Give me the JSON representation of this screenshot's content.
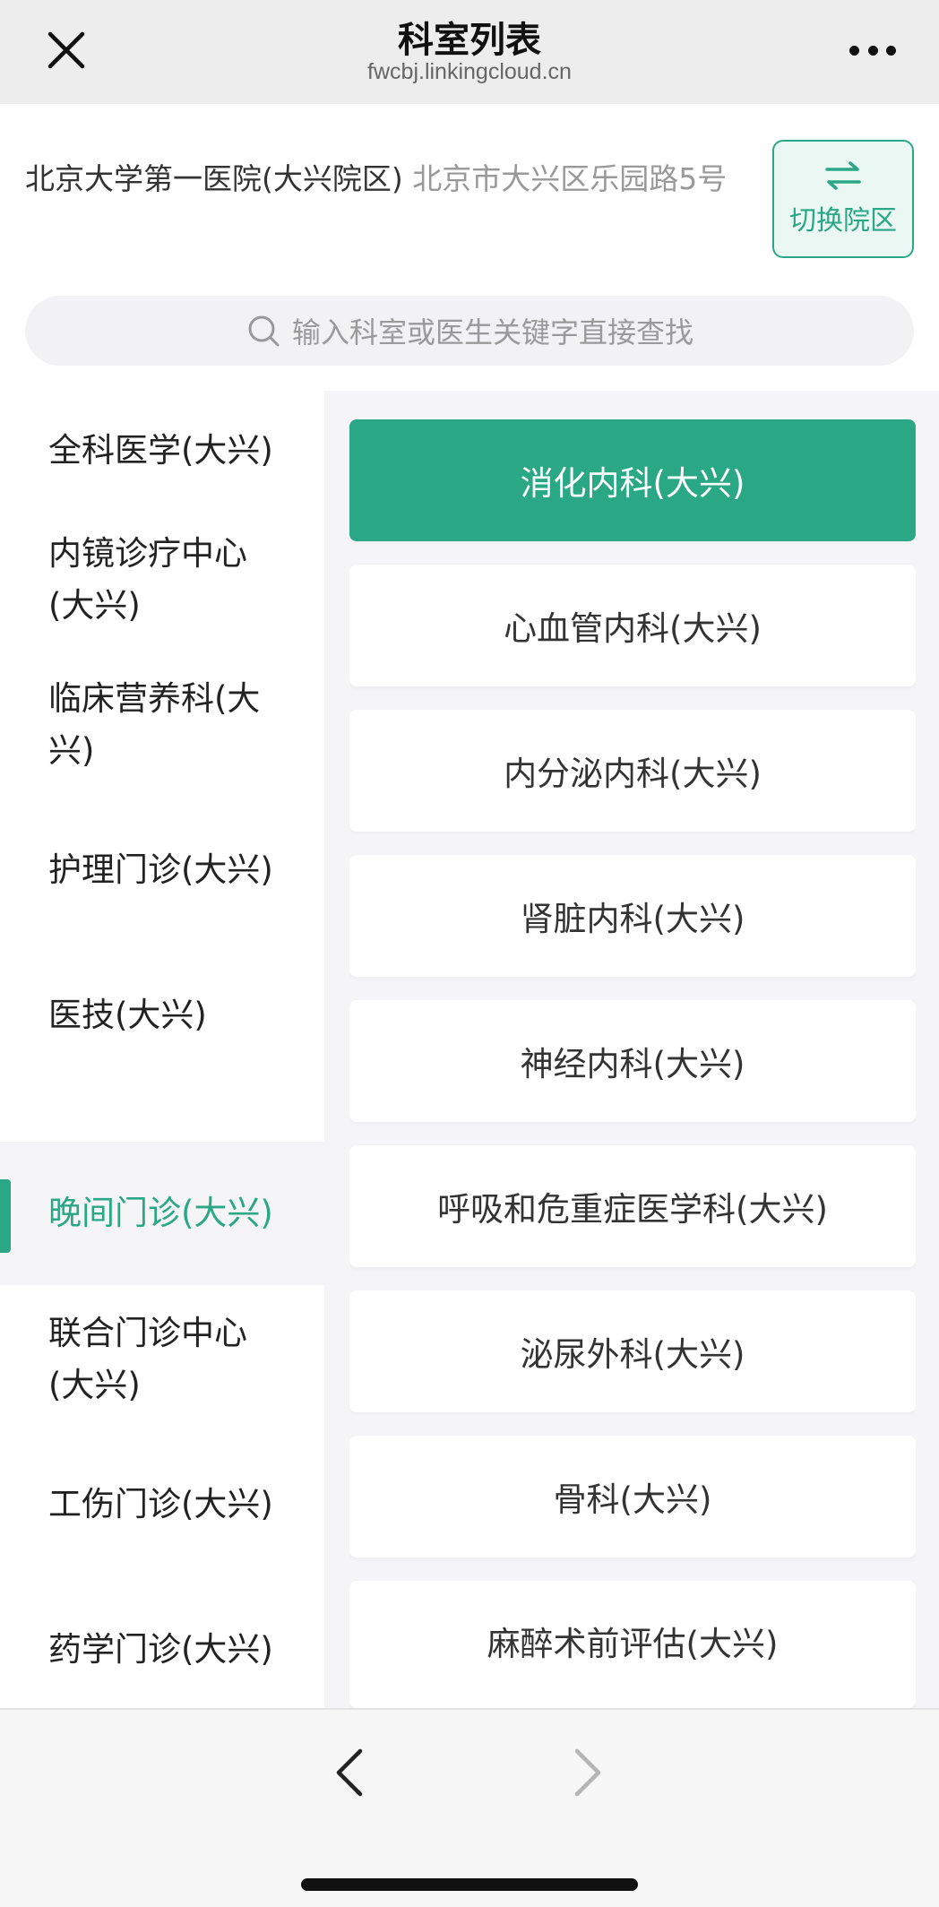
{
  "nav": {
    "title": "科室列表",
    "url": "fwcbj.linkingcloud.cn",
    "close_icon": "close-icon",
    "more_icon": "more-dots-icon"
  },
  "hospital": {
    "name": "北京大学第一医院(大兴院区)",
    "address": "北京市大兴区乐园路5号",
    "switch_label": "切换院区",
    "switch_icon": "swap-arrows-icon"
  },
  "search": {
    "placeholder": "输入科室或医生关键字直接查找",
    "icon": "search-icon"
  },
  "colors": {
    "accent": "#2aa885",
    "background": "#f5f5f7"
  },
  "sidebar": {
    "items": [
      {
        "label": "全科医学(大兴)"
      },
      {
        "label": "内镜诊疗中心(大兴)"
      },
      {
        "label": "临床营养科(大兴)"
      },
      {
        "label": "护理门诊(大兴)"
      },
      {
        "label": "医技(大兴)"
      },
      {
        "label": "晚间门诊(大兴)",
        "active": true
      },
      {
        "label": "联合门诊中心(大兴)"
      },
      {
        "label": "工伤门诊(大兴)"
      },
      {
        "label": "药学门诊(大兴)"
      }
    ]
  },
  "departments": {
    "items": [
      {
        "label": "消化内科(大兴)",
        "selected": true
      },
      {
        "label": "心血管内科(大兴)"
      },
      {
        "label": "内分泌内科(大兴)"
      },
      {
        "label": "肾脏内科(大兴)"
      },
      {
        "label": "神经内科(大兴)"
      },
      {
        "label": "呼吸和危重症医学科(大兴)"
      },
      {
        "label": "泌尿外科(大兴)"
      },
      {
        "label": "骨科(大兴)"
      },
      {
        "label": "麻醉术前评估(大兴)"
      }
    ]
  },
  "toolbar": {
    "back_icon": "chevron-left-icon",
    "forward_icon": "chevron-right-icon"
  }
}
